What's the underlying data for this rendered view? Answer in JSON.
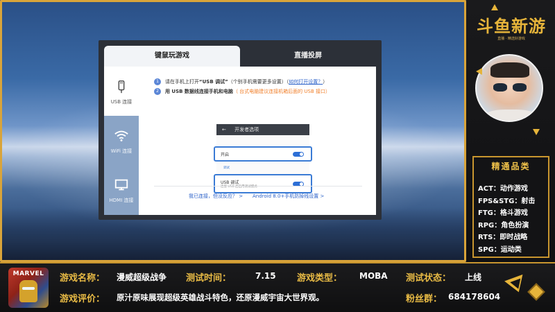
{
  "dialog": {
    "tabs": [
      {
        "label": "键鼠玩游戏",
        "active": true
      },
      {
        "label": "直播投屏",
        "active": false
      }
    ],
    "side_nav": [
      {
        "label": "USB 连接",
        "icon": "usb-icon",
        "active": true
      },
      {
        "label": "WiFi 连接",
        "icon": "wifi-icon",
        "active": false
      },
      {
        "label": "HDMI 连接",
        "icon": "hdmi-icon",
        "active": false
      }
    ],
    "steps": [
      {
        "num": "1",
        "text_a": "请在手机上打开",
        "text_b": "“USB 调试”",
        "text_c": "（个别手机需要更多设置）（",
        "link": "如何打开设置？",
        "text_d": "）"
      },
      {
        "num": "2",
        "text_a": "用 USB 数据线连接手机和电脑",
        "note": "（ 台式电脑建议连接机箱后面的 USB 接口）"
      }
    ],
    "phone": {
      "header_back": "←",
      "header_title": "开发者选项",
      "option_on_label": "开启",
      "debug_section": "调试",
      "usb_label": "USB 调试",
      "usb_sub": "连接 USB 后启用调试模式"
    },
    "links": {
      "connected": "我已连接，但没反应？ >",
      "android": "Android 8.0+手机防掉线设置 >"
    }
  },
  "side_panel": {
    "logo_text": "斗鱼新游",
    "logo_sub": "直播 · 精选好游戏",
    "genre_title": "精通品类",
    "genres": [
      "ACT：动作游戏",
      "FPS&STG：射击",
      "FTG：格斗游戏",
      "RPG：角色扮演",
      "RTS：即时战略",
      "SPG：运动类"
    ]
  },
  "info_bar": {
    "thumb_label": "MARVEL",
    "name_label": "游戏名称：",
    "name_value": "漫威超级战争",
    "time_label": "测试时间：",
    "time_value": "7.15",
    "type_label": "游戏类型：",
    "type_value": "MOBA",
    "status_label": "测试状态：",
    "status_value": "上线",
    "review_label": "游戏评价：",
    "review_value": "原汁原味展现超级英雄战斗特色，还原漫威宇宙大世界观。",
    "fans_label": "粉丝群：",
    "fans_value": "684178604"
  },
  "colors": {
    "gold": "#e6b43a",
    "accent_blue": "#3a7bd5",
    "nav_blue": "#8aa4c6",
    "orange_note": "#f07f2a"
  }
}
